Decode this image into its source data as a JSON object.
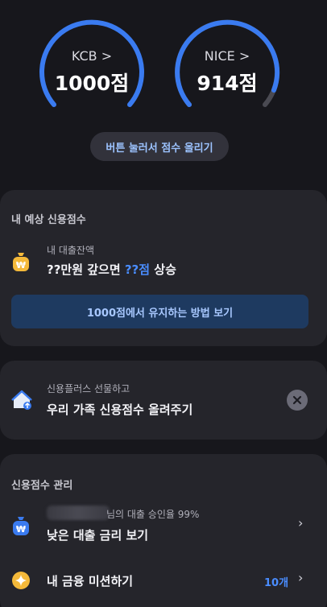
{
  "gauges": [
    {
      "label": "KCB >",
      "score": "1000점",
      "fill_fraction": 1.0
    },
    {
      "label": "NICE >",
      "score": "914점",
      "fill_fraction": 0.914
    }
  ],
  "raise_button_label": "버튼 눌러서 점수 올리기",
  "predicted_card": {
    "title": "내 예상 신용점수",
    "subtitle": "내 대출잔액",
    "headline_prefix": "??만원 갚으면 ",
    "headline_highlight": "??점",
    "headline_suffix": " 상승",
    "action_label": "1000점에서 유지하는 방법 보기"
  },
  "promo_card": {
    "subtitle": "신용플러스 선물하고",
    "headline": "우리 가족 신용점수 올려주기"
  },
  "manage_card": {
    "title": "신용점수 관리",
    "loan_subtitle": "님의 대출 승인율 99%",
    "loan_headline": "낮은 대출 금리 보기",
    "mission_label": "내 금융 미션하기",
    "mission_count": "10개"
  },
  "colors": {
    "background": "#17171c",
    "card": "#25252b",
    "accent_blue": "#3a7bf0",
    "coin_gold": "#f4b93a"
  }
}
